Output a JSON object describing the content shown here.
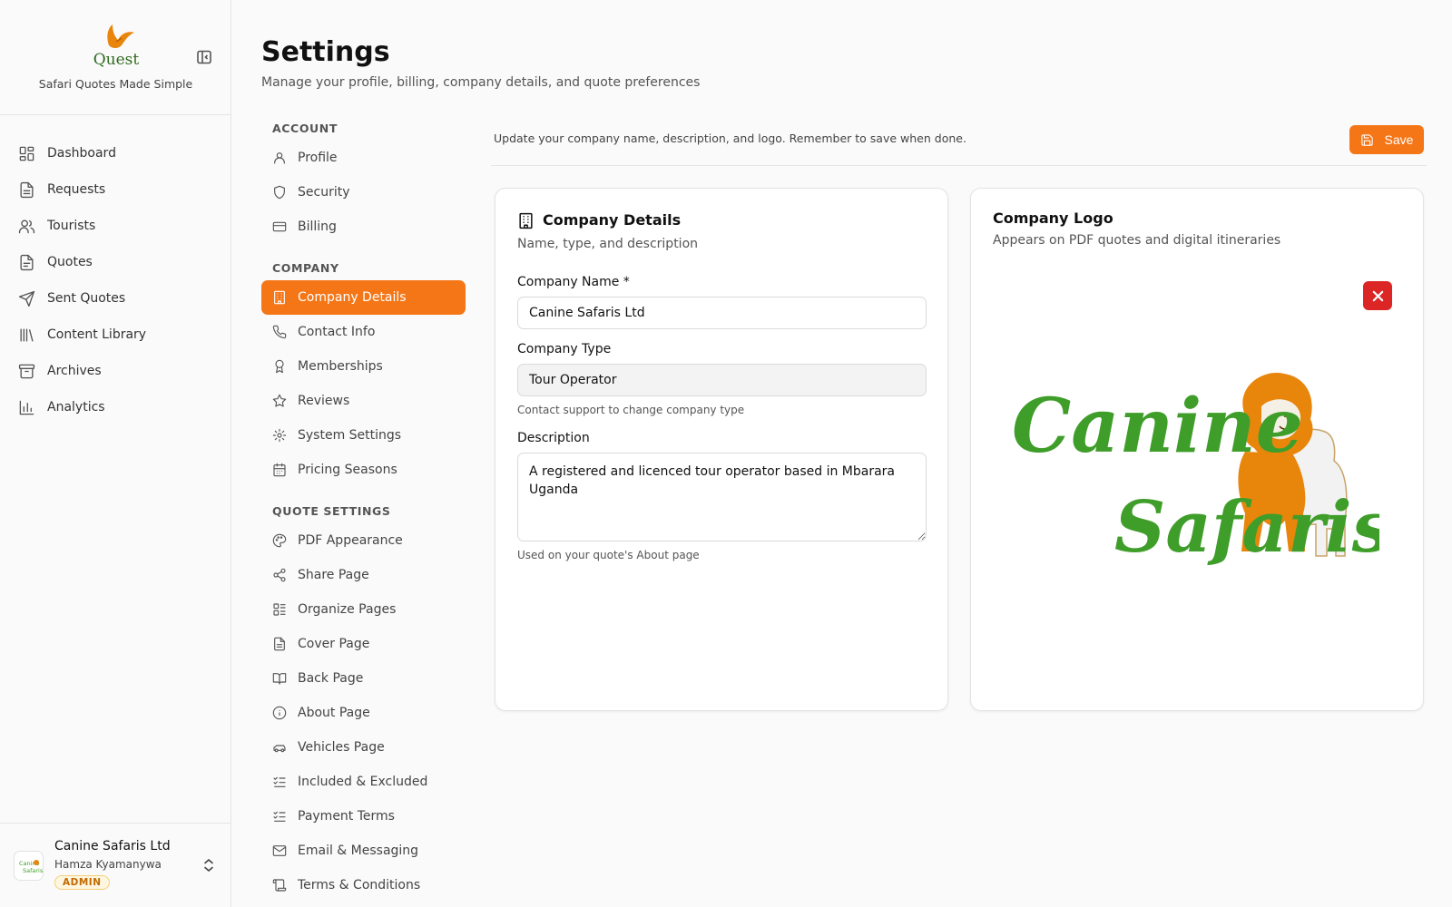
{
  "sidebar": {
    "brand_name": "Quest",
    "tagline": "Safari Quotes Made Simple",
    "nav": [
      {
        "label": "Dashboard",
        "icon": "dashboard-icon"
      },
      {
        "label": "Requests",
        "icon": "file-icon"
      },
      {
        "label": "Tourists",
        "icon": "users-icon"
      },
      {
        "label": "Quotes",
        "icon": "file-text-icon"
      },
      {
        "label": "Sent Quotes",
        "icon": "send-icon"
      },
      {
        "label": "Content Library",
        "icon": "library-icon"
      },
      {
        "label": "Archives",
        "icon": "archive-icon"
      },
      {
        "label": "Analytics",
        "icon": "chart-icon"
      }
    ],
    "user": {
      "company": "Canine Safaris Ltd",
      "name": "Hamza Kyamanywa",
      "role": "ADMIN"
    }
  },
  "header": {
    "title": "Settings",
    "subtitle": "Manage your profile, billing, company details, and quote preferences"
  },
  "settings_nav": {
    "account_heading": "ACCOUNT",
    "account": [
      {
        "label": "Profile",
        "icon": "user-icon"
      },
      {
        "label": "Security",
        "icon": "shield-icon"
      },
      {
        "label": "Billing",
        "icon": "credit-card-icon"
      }
    ],
    "company_heading": "COMPANY",
    "company": [
      {
        "label": "Company Details",
        "icon": "building-icon",
        "active": true
      },
      {
        "label": "Contact Info",
        "icon": "phone-icon"
      },
      {
        "label": "Memberships",
        "icon": "award-icon"
      },
      {
        "label": "Reviews",
        "icon": "star-icon"
      },
      {
        "label": "System Settings",
        "icon": "gear-icon"
      },
      {
        "label": "Pricing Seasons",
        "icon": "calendar-icon"
      }
    ],
    "quote_heading": "QUOTE SETTINGS",
    "quote": [
      {
        "label": "PDF Appearance",
        "icon": "palette-icon"
      },
      {
        "label": "Share Page",
        "icon": "share-icon"
      },
      {
        "label": "Organize Pages",
        "icon": "layout-list-icon"
      },
      {
        "label": "Cover Page",
        "icon": "file-text-icon"
      },
      {
        "label": "Back Page",
        "icon": "book-open-icon"
      },
      {
        "label": "About Page",
        "icon": "info-icon"
      },
      {
        "label": "Vehicles Page",
        "icon": "car-icon"
      },
      {
        "label": "Included & Excluded",
        "icon": "list-checks-icon"
      },
      {
        "label": "Payment Terms",
        "icon": "list-checks-icon"
      },
      {
        "label": "Email & Messaging",
        "icon": "mail-icon"
      },
      {
        "label": "Terms & Conditions",
        "icon": "scroll-icon"
      }
    ]
  },
  "content": {
    "note": "Update your company name, description, and logo. Remember to save when done.",
    "save_label": "Save"
  },
  "details_card": {
    "title": "Company Details",
    "subtitle": "Name, type, and description",
    "name_label": "Company Name *",
    "name_value": "Canine Safaris Ltd",
    "type_label": "Company Type",
    "type_value": "Tour Operator",
    "type_help": "Contact support to change company type",
    "description_label": "Description",
    "description_value": "A registered and licenced tour operator based in Mbarara Uganda",
    "description_help": "Used on your quote's About page"
  },
  "logo_card": {
    "title": "Company Logo",
    "subtitle": "Appears on PDF quotes and digital itineraries",
    "logo_text_1": "Canine",
    "logo_text_2": "Safaris"
  },
  "colors": {
    "accent": "#f57617",
    "danger": "#dc2626",
    "logo_green": "#3f9e2a",
    "logo_orange": "#e8860c"
  }
}
